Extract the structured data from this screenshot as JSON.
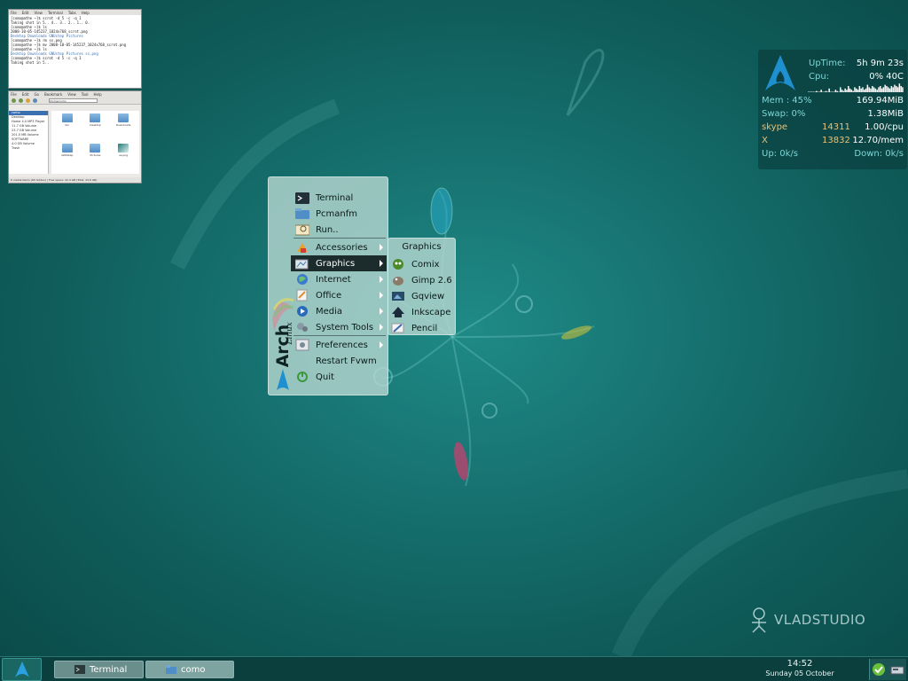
{
  "terminal_window": {
    "menu": [
      "File",
      "Edit",
      "View",
      "Terminal",
      "Tabs",
      "Help"
    ],
    "lines": [
      "[como@athe ~]$ scrot -d 5 -c -q 1",
      "Taking shot in 5.. 4.. 3.. 2.. 1.. 0.",
      "[como@athe ~]$ ls",
      "2008-10-05-145237_1024x768_scrot.png",
      "Desktop  Downloads  GNUstep  Pictures",
      "[como@athe ~]$ rm ss.png",
      "[como@athe ~]$ mv 2008-10-05-145237_1024x768_scrot.png",
      "[como@athe ~]$ ls",
      "Desktop  Downloads  GNUstep  Pictures  ss.png",
      "[como@athe ~]$ scrot -d 5 -c -q 1",
      "Taking shot in 5.."
    ]
  },
  "filemanager_window": {
    "menu": [
      "File",
      "Edit",
      "Go",
      "Bookmark",
      "View",
      "Tool",
      "Help"
    ],
    "path": "/home/como",
    "sidebar": [
      "como",
      "Desktop",
      "Home 4.0 MP3 Player",
      "11.7 GB Volume",
      "23.7 GB Volume",
      "201.0 MB Volume",
      "SOFTWARE",
      "4.0 GB Volume",
      "Trash"
    ],
    "files": [
      "bin",
      "Desktop",
      "Downloads",
      "GNUstep",
      "Pictures",
      "ss.png"
    ],
    "status": "6 visible items (65 hidden) | Free space: 22.4 GB (Total: 23.6 GB)"
  },
  "conky": {
    "uptime_label": "UpTime:",
    "uptime_value": "5h 9m 23s",
    "cpu_label": "Cpu:",
    "cpu_value": "0% 40C",
    "mem_label": "Mem : 45%",
    "mem_value": "169.94MiB",
    "swap_label": "Swap: 0%",
    "swap_value": "1.38MiB",
    "proc1_name": "skype",
    "proc1_pid": "14311",
    "proc1_val": "1.00/cpu",
    "proc2_name": "X",
    "proc2_pid": "13832",
    "proc2_val": "12.70/mem",
    "up_label": "Up: 0k/s",
    "down_label": "Down: 0k/s",
    "cpu_history": [
      0,
      0,
      0,
      0,
      0,
      1,
      0,
      0,
      2,
      0,
      0,
      1,
      0,
      3,
      0,
      0,
      0,
      2,
      1,
      0,
      4,
      2,
      1,
      3,
      2,
      5,
      3,
      2,
      1,
      4,
      3,
      2,
      5,
      3,
      4,
      2,
      3,
      6,
      4,
      3,
      5,
      4,
      3,
      2,
      4,
      5,
      3,
      4,
      6,
      5,
      4,
      3,
      5,
      4,
      6,
      5,
      4,
      7,
      5,
      4
    ]
  },
  "menu": {
    "brand_text": "Arch",
    "brand_sub": "Linux",
    "items": [
      {
        "label": "Terminal",
        "icon": "terminal-icon"
      },
      {
        "label": "Pcmanfm",
        "icon": "folder-icon"
      },
      {
        "label": "Run..",
        "icon": "run-icon"
      },
      {
        "label": "Accessories",
        "icon": "accessories-icon"
      },
      {
        "label": "Graphics",
        "icon": "graphics-icon"
      },
      {
        "label": "Internet",
        "icon": "internet-icon"
      },
      {
        "label": "Office",
        "icon": "office-icon"
      },
      {
        "label": "Media",
        "icon": "media-icon"
      },
      {
        "label": "System Tools",
        "icon": "system-tools-icon"
      },
      {
        "label": "Preferences",
        "icon": "preferences-icon"
      },
      {
        "label": "Restart Fvwm",
        "icon": "restart-icon"
      },
      {
        "label": "Quit",
        "icon": "quit-icon"
      }
    ]
  },
  "submenu": {
    "title": "Graphics",
    "items": [
      {
        "label": "Comix",
        "icon": "comix-icon"
      },
      {
        "label": "Gimp 2.6",
        "icon": "gimp-icon"
      },
      {
        "label": "Gqview",
        "icon": "gqview-icon"
      },
      {
        "label": "Inkscape",
        "icon": "inkscape-icon"
      },
      {
        "label": "Pencil",
        "icon": "pencil-icon"
      }
    ]
  },
  "watermark": "VLADSTUDIO",
  "taskbar": {
    "tasks": [
      {
        "label": "Terminal",
        "icon": "terminal-icon"
      },
      {
        "label": "como",
        "icon": "folder-icon"
      }
    ],
    "time": "14:52",
    "date": "Sunday 05 October"
  },
  "colors": {
    "desktop_bg": "#16716f",
    "menu_bg": "#b4d6d0",
    "menu_active": "#1c2b2b",
    "conky_label": "#7fd6d6",
    "conky_accent": "#e8c27a",
    "taskbar_bg": "#0b3f3e"
  }
}
